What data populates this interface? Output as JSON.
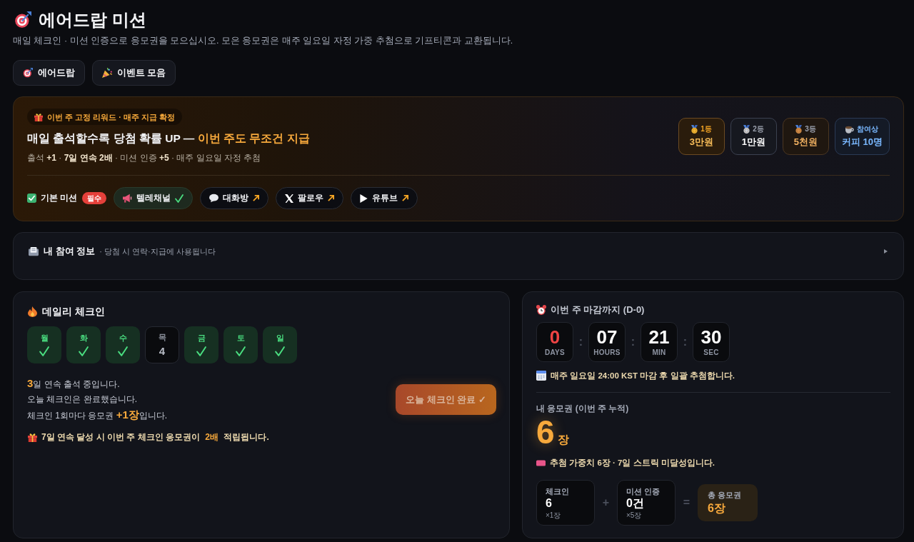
{
  "header": {
    "title": "에어드랍 미션",
    "subtitle": "매일 체크인 · 미션 인증으로 응모권을 모으십시오. 모은 응모권은 매주 일요일 자정 가중 추첨으로 기프티콘과 교환됩니다."
  },
  "nav_buttons": [
    {
      "label": "에어드랍"
    },
    {
      "label": "이벤트 모음"
    }
  ],
  "banner": {
    "tag": "이번 주 고정 리워드 · 매주 지급 확정",
    "headline": "매일 출석할수록 당첨 확률 UP — **이번 주도 무조건 지급**",
    "subline": "출석 **+1** · **7일 연속 2배** · 미션 인증 **+5** · 매주 일요일 자정 추첨",
    "prizes": [
      {
        "kind": "first",
        "rank": "1등",
        "amount": "3만원"
      },
      {
        "kind": "second",
        "rank": "2등",
        "amount": "1만원"
      },
      {
        "kind": "third",
        "rank": "3등",
        "amount": "5천원"
      },
      {
        "kind": "participation",
        "rank": "참여상",
        "amount": "커피 10명"
      }
    ],
    "missions": {
      "label": "기본 미션",
      "badge": "필수",
      "items": [
        {
          "label": "텔레채널",
          "completed": true
        },
        {
          "label": "대화방",
          "completed": false
        },
        {
          "label": "팔로우",
          "completed": false
        },
        {
          "label": "유튜브",
          "completed": false
        }
      ]
    }
  },
  "info_panel": {
    "title": "내 참여 정보",
    "note": "· 당첨 시 연락·지급에 사용됩니다",
    "expanded": false
  },
  "checkin": {
    "title": "데일리 체크인",
    "days": [
      {
        "label": "월",
        "checked": true
      },
      {
        "label": "화",
        "checked": true
      },
      {
        "label": "수",
        "checked": true
      },
      {
        "label": "목",
        "checked": false,
        "value": "4"
      },
      {
        "label": "금",
        "checked": true
      },
      {
        "label": "토",
        "checked": true
      },
      {
        "label": "일",
        "checked": true
      }
    ],
    "status_lines": [
      "**3**일 연속 출석 중입니다.",
      "오늘 체크인은 완료했습니다.",
      "체크인 1회마다 응모권 **+1장**입니다."
    ],
    "bonus_note": "7일 연속 달성 시 이번 주 체크인 응모권이 **2배** 적립됩니다.",
    "button": {
      "label": "오늘 체크인 완료 ✓",
      "disabled": true
    }
  },
  "deadline": {
    "title": "이번 주 마감까지 (D-0)",
    "countdown": [
      {
        "value": "0",
        "unit": "DAYS",
        "color": "#ef4444",
        "separator": ":"
      },
      {
        "value": "07",
        "unit": "HOURS",
        "color": "#ffffff",
        "separator": ":"
      },
      {
        "value": "21",
        "unit": "MIN",
        "color": "#ffffff",
        "separator": ":"
      },
      {
        "value": "30",
        "unit": "SEC",
        "color": "#ffffff"
      }
    ],
    "note": "매주 일요일 24:00 KST 마감 후 일괄 추첨합니다."
  },
  "tickets": {
    "label": "내 응모권 (이번 주 누적)",
    "count": "6",
    "unit": "장",
    "note": "추첨 가중치 6장 · 7일 스트릭 미달성입니다.",
    "breakdown": [
      {
        "kind": "term",
        "label": "체크인",
        "value": "6",
        "multiplier": "×1장"
      },
      {
        "kind": "operator",
        "symbol": "+"
      },
      {
        "kind": "term",
        "label": "미션 인증",
        "value": "0건",
        "multiplier": "×5장"
      },
      {
        "kind": "operator",
        "symbol": "="
      },
      {
        "kind": "total",
        "label": "총 응모권",
        "value": "6장"
      }
    ]
  }
}
